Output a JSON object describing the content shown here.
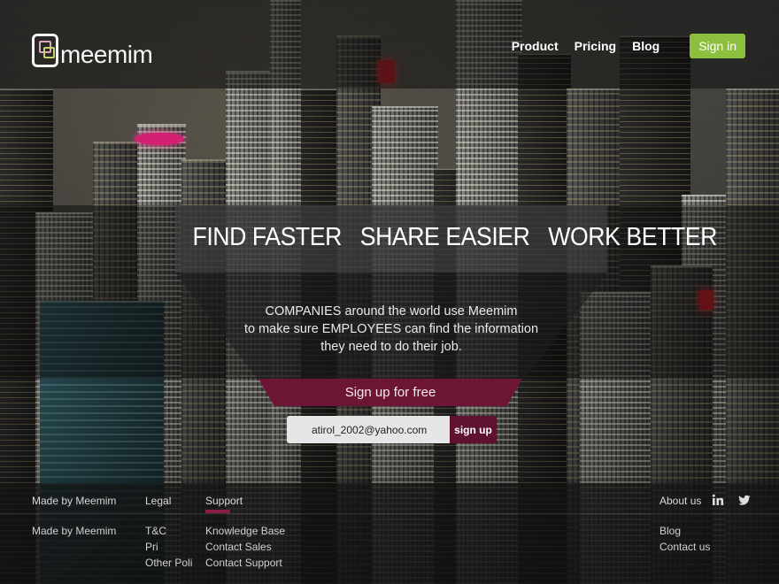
{
  "brand": {
    "logo_text": "meemim"
  },
  "nav": {
    "items": [
      "Product",
      "Pricing",
      "Blog"
    ],
    "signin_label": "Sign in",
    "signin_color": "#8dbf3e"
  },
  "hero": {
    "headline": "FIND FASTER   SHARE EASIER   WORK BETTER",
    "tagline_lines": [
      "COMPANIES around the world use Meemim",
      "to make sure EMPLOYEES can find the information",
      "they need to do their job."
    ],
    "signup_banner": "Sign up for free",
    "banner_color": "#6c1535",
    "email_value": "atirol_2002@yahoo.com",
    "signup_button": "sign up"
  },
  "footer": {
    "made_by_heading": "Made by Meemim",
    "made_by_text": "Made by Meemim",
    "legal_heading": "Legal",
    "legal_items": [
      "T&C",
      "Pri",
      "Other Poli"
    ],
    "support_heading": "Support",
    "support_items": [
      "Knowledge Base",
      "Contact Sales",
      "Contact Support"
    ],
    "about_heading": "About us",
    "about_items": [
      "Blog",
      "Contact us"
    ],
    "social_icons": [
      "linkedin-icon",
      "twitter-icon"
    ]
  }
}
